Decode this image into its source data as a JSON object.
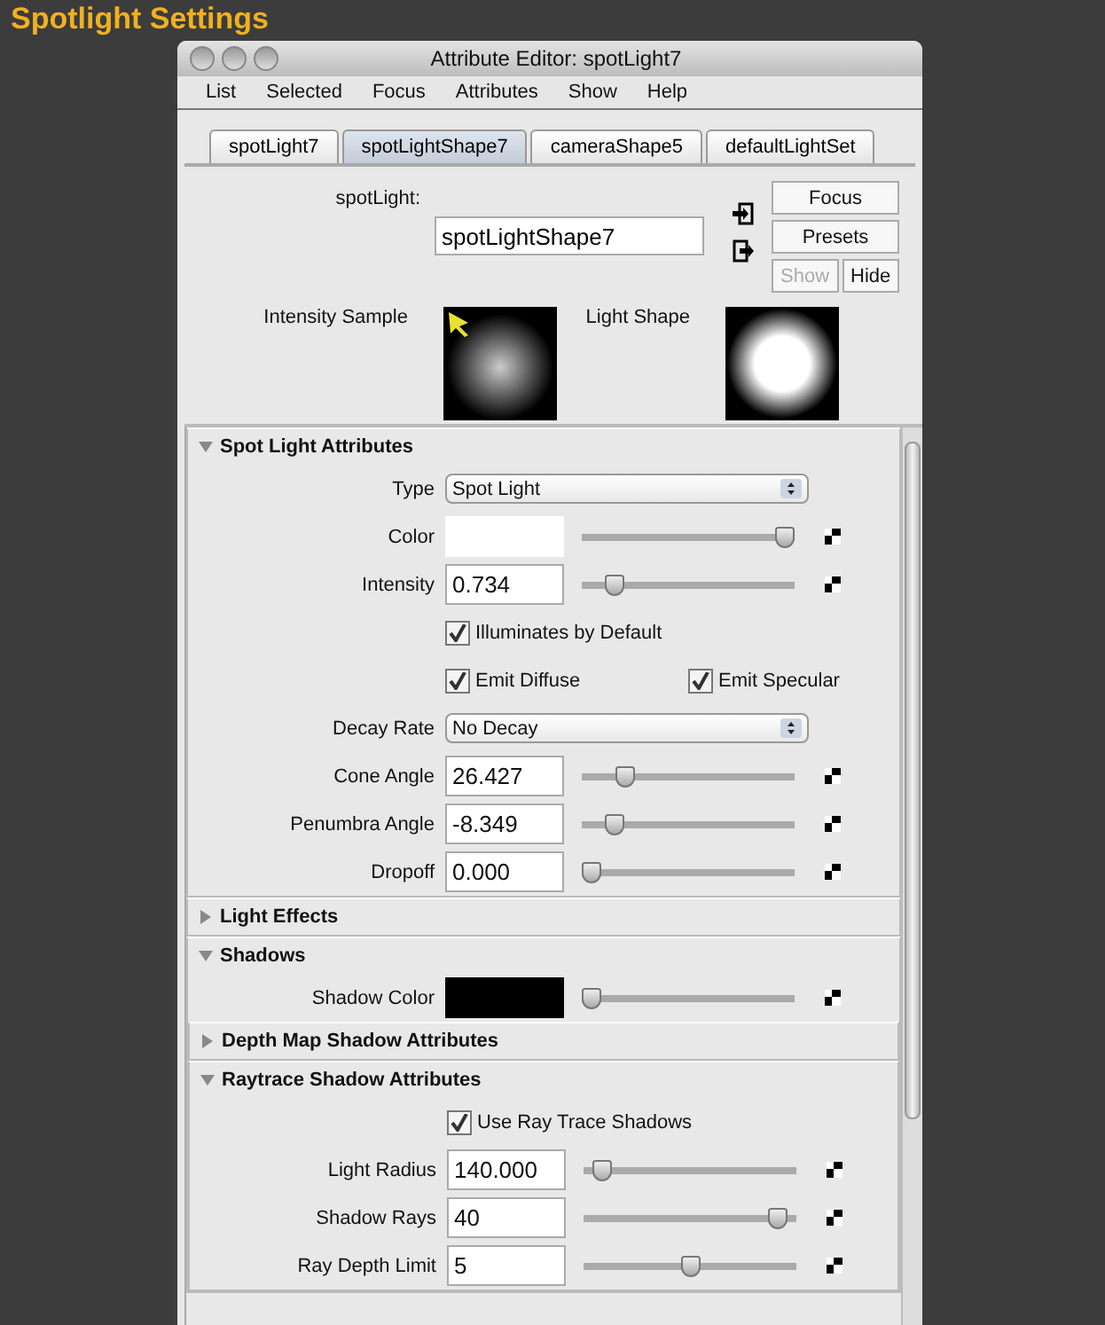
{
  "page_title": "Spotlight Settings",
  "window": {
    "title": "Attribute Editor: spotLight7"
  },
  "menu": [
    "List",
    "Selected",
    "Focus",
    "Attributes",
    "Show",
    "Help"
  ],
  "tabs": [
    {
      "label": "spotLight7",
      "selected": false
    },
    {
      "label": "spotLightShape7",
      "selected": true
    },
    {
      "label": "cameraShape5",
      "selected": false
    },
    {
      "label": "defaultLightSet",
      "selected": false
    }
  ],
  "node": {
    "label": "spotLight:",
    "value": "spotLightShape7"
  },
  "buttons": [
    {
      "label": "Focus",
      "disabled": false
    },
    {
      "label": "Presets",
      "disabled": false
    }
  ],
  "show_hide": [
    {
      "label": "Show",
      "disabled": true
    },
    {
      "label": "Hide",
      "disabled": false
    }
  ],
  "samples": [
    {
      "label": "Intensity Sample",
      "kind": "intensity"
    },
    {
      "label": "Light Shape",
      "kind": "shape"
    }
  ],
  "sections": [
    {
      "title": "Spot Light Attributes",
      "expanded": true,
      "rows": [
        {
          "kind": "dropdown",
          "label": "Type",
          "value": "Spot Light"
        },
        {
          "kind": "color",
          "label": "Color",
          "color": "#ffffff",
          "level": 1
        },
        {
          "kind": "number",
          "label": "Intensity",
          "value": "0.734",
          "level": 0.12
        },
        {
          "kind": "checkbox",
          "items": [
            {
              "label": "Illuminates by Default",
              "checked": true
            }
          ]
        },
        {
          "kind": "checkbox",
          "items": [
            {
              "label": "Emit Diffuse",
              "checked": true
            },
            {
              "label": "Emit Specular",
              "checked": true
            }
          ]
        },
        {
          "kind": "dropdown",
          "label": "Decay Rate",
          "value": "No Decay"
        },
        {
          "kind": "number",
          "label": "Cone Angle",
          "value": "26.427",
          "level": 0.17
        },
        {
          "kind": "number",
          "label": "Penumbra Angle",
          "value": "-8.349",
          "level": 0.12
        },
        {
          "kind": "number",
          "label": "Dropoff",
          "value": "0.000",
          "level": 0
        }
      ]
    },
    {
      "title": "Light Effects",
      "expanded": false
    },
    {
      "title": "Shadows",
      "expanded": true,
      "rows": [
        {
          "kind": "color",
          "label": "Shadow Color",
          "color": "#000000",
          "level": 0
        }
      ],
      "children": [
        {
          "title": "Depth Map Shadow Attributes",
          "expanded": false
        },
        {
          "title": "Raytrace Shadow Attributes",
          "expanded": true,
          "rows": [
            {
              "kind": "checkbox",
              "items": [
                {
                  "label": "Use Ray Trace Shadows",
                  "checked": true
                }
              ]
            },
            {
              "kind": "number",
              "label": "Light Radius",
              "value": "140.000",
              "level": 0.05
            },
            {
              "kind": "number",
              "label": "Shadow Rays",
              "value": "40",
              "level": 0.95
            },
            {
              "kind": "number",
              "label": "Ray Depth Limit",
              "value": "5",
              "level": 0.5
            }
          ]
        }
      ]
    }
  ]
}
